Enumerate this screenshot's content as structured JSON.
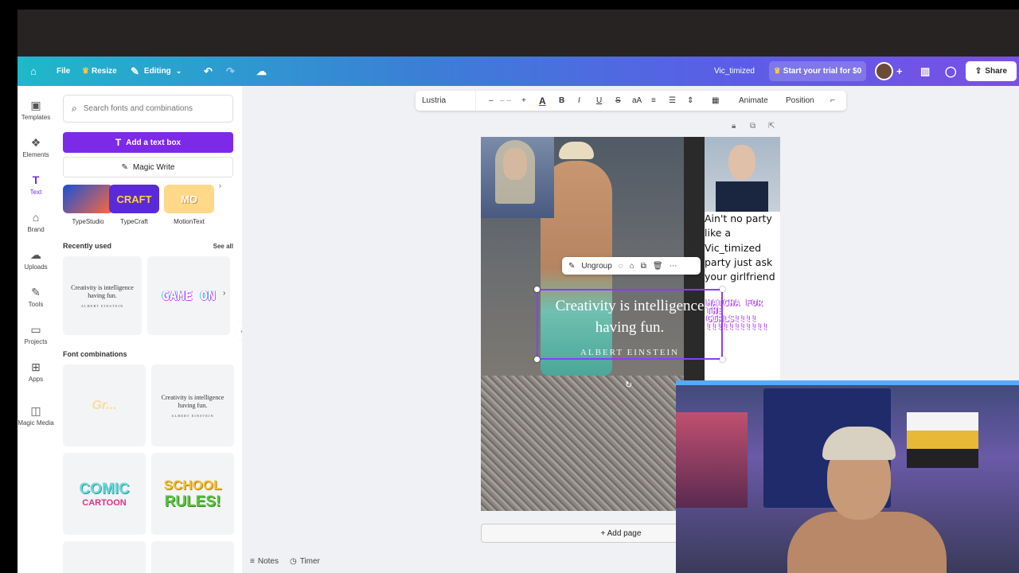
{
  "header": {
    "home_icon": "home-icon",
    "file": "File",
    "resize": "Resize",
    "editing": "Editing",
    "doc_title": "Vic_timized",
    "trial": "Start your trial for $0",
    "share": "Share"
  },
  "rail": {
    "items": [
      {
        "label": "Templates",
        "icon": "templates-icon"
      },
      {
        "label": "Elements",
        "icon": "elements-icon"
      },
      {
        "label": "Text",
        "icon": "text-icon"
      },
      {
        "label": "Brand",
        "icon": "brand-icon"
      },
      {
        "label": "Uploads",
        "icon": "uploads-icon"
      },
      {
        "label": "Tools",
        "icon": "tools-icon"
      },
      {
        "label": "Projects",
        "icon": "projects-icon"
      },
      {
        "label": "Apps",
        "icon": "apps-icon"
      },
      {
        "label": "Magic Media",
        "icon": "magic-media-icon"
      }
    ]
  },
  "panel": {
    "search_placeholder": "Search fonts and combinations",
    "add_text_box": "Add a text box",
    "magic_write": "Magic Write",
    "styles": [
      {
        "label": "TypeStudio"
      },
      {
        "label": "TypeCraft",
        "art": "CRAFT"
      },
      {
        "label": "MotionText",
        "art": "MO"
      }
    ],
    "recently_used": "Recently used",
    "see_all": "See all",
    "recent_quote": "Creativity is intelligence having fun.",
    "recent_author": "ALBERT EINSTEIN",
    "recent_art": "GAME ON",
    "font_combinations": "Font combinations",
    "combo_quote": "Creativity is intelligence having fun.",
    "combo_author": "ALBERT EINSTEIN",
    "combo_comic_1": "COMIC",
    "combo_comic_2": "CARTOON",
    "combo_school_1": "SCHOOL",
    "combo_school_2": "RULES!"
  },
  "toolbar": {
    "font": "Lustria",
    "minus": "–",
    "size": "– –",
    "plus": "+",
    "bold": "B",
    "italic": "I",
    "underline": "U",
    "strike": "S",
    "case": "aA",
    "animate": "Animate",
    "position": "Position"
  },
  "canvas": {
    "context_ungroup": "Ungroup",
    "quote": "Creativity is intelligence having fun.",
    "author": "ALBERT EINSTEIN",
    "hand_text": "Ain't no party\nlike a\nVic_timized\nparty just ask\nyour girlfriend",
    "pixel_text": "MATCHA FOR THE GIRLS!!!! !!!!!!!!!!!",
    "add_page": "+ Add page"
  },
  "bottom": {
    "notes": "Notes",
    "timer": "Timer"
  },
  "colors": {
    "accent": "#7d2ae8",
    "selection": "#8b3dff"
  }
}
